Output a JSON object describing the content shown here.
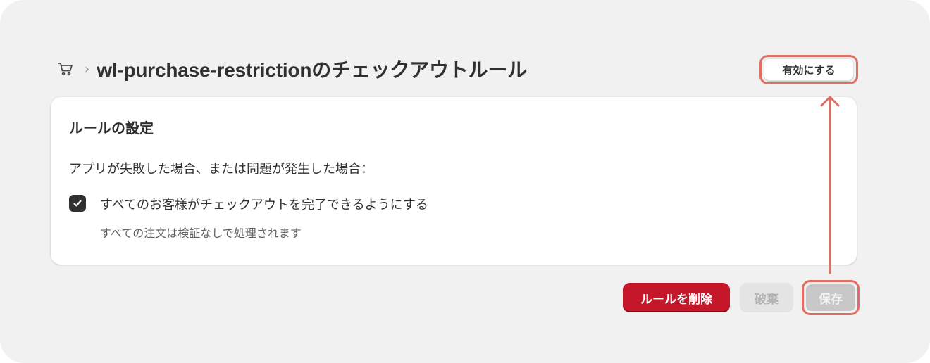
{
  "header": {
    "breadcrumb_icon": "cart-icon",
    "separator": "›",
    "title": "wl-purchase-restrictionのチェックアウトルール",
    "enable_button": "有効にする"
  },
  "card": {
    "title": "ルールの設定",
    "question": "アプリが失敗した場合、または問題が発生した場合：",
    "checkbox": {
      "checked": true,
      "label": "すべてのお客様がチェックアウトを完了できるようにする",
      "help": "すべての注文は検証なしで処理されます"
    }
  },
  "actions": {
    "delete_label": "ルールを削除",
    "discard_label": "破棄",
    "save_label": "保存"
  },
  "colors": {
    "background": "#f1f1f1",
    "highlight": "#e06e63",
    "delete": "#c5162a",
    "text": "#303030"
  }
}
